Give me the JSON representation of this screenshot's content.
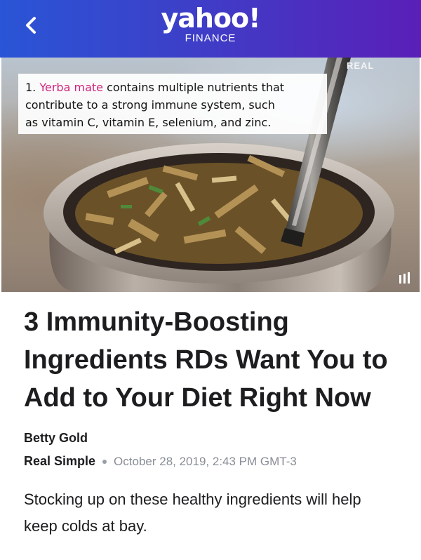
{
  "header": {
    "logo_word": "yahoo!",
    "logo_sub": "FINANCE",
    "icons": {
      "back": "chevron-left-icon"
    }
  },
  "hero": {
    "caption_number": "1.",
    "caption_highlight": "Yerba mate",
    "caption_rest_line1": "contains multiple nutrients that",
    "caption_line2": "contribute to a strong immune system, such",
    "caption_line3": "as vitamin C, vitamin E, selenium, and zinc.",
    "watermark": "REAL",
    "icons": {
      "bars": "signal-bars-icon"
    }
  },
  "article": {
    "title": "3 Immunity-Boosting Ingredients RDs Want You to Add to Your Diet Right Now",
    "author": "Betty Gold",
    "source": "Real Simple",
    "date": "October 28, 2019, 2:43 PM GMT-3",
    "summary": "Stocking up on these healthy ingredients will help keep colds at bay."
  },
  "colors": {
    "header_start": "#2a55d6",
    "header_end": "#5a1fb8",
    "caption_highlight": "#d0237a",
    "meta_gray": "#888d96"
  }
}
